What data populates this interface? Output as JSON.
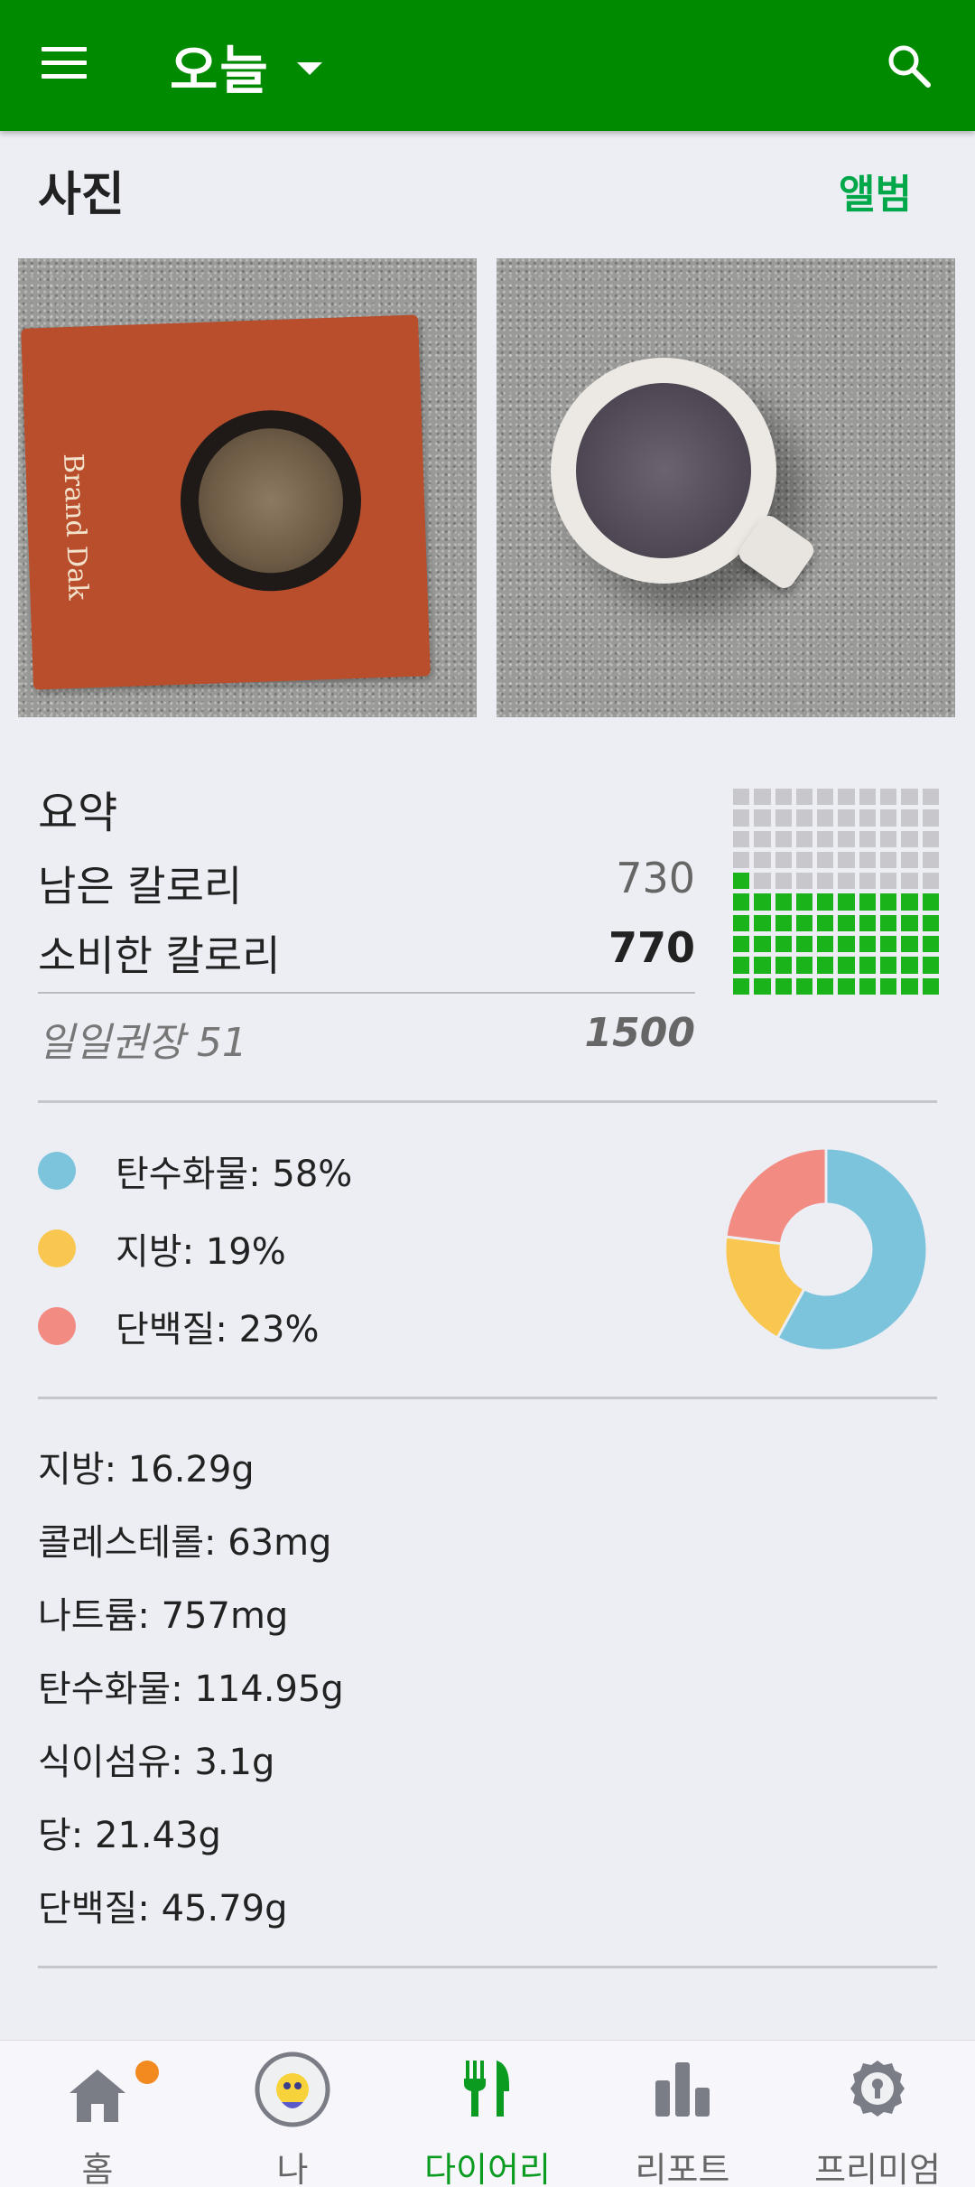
{
  "appbar": {
    "title": "오늘",
    "menu_icon": "menu-icon",
    "search_icon": "search-icon"
  },
  "photos": {
    "title": "사진",
    "album_link": "앨범",
    "items": [
      {
        "brand_text": "Brand Dak"
      },
      {}
    ]
  },
  "summary": {
    "title": "요약",
    "remaining_label": "남은 칼로리",
    "remaining_value": "730",
    "consumed_label": "소비한 칼로리",
    "consumed_value": "770",
    "daily_label": "일일권장 51",
    "daily_value": "1500",
    "grid_filled_fraction": 0.51
  },
  "macros": {
    "items": [
      {
        "label": "탄수화물: 58%",
        "percent": 58,
        "color": "#7cc3dc"
      },
      {
        "label": "지방: 19%",
        "percent": 19,
        "color": "#f9c74f"
      },
      {
        "label": "단백질: 23%",
        "percent": 23,
        "color": "#f28b82"
      }
    ]
  },
  "nutrients": [
    "지방: 16.29g",
    "콜레스테롤: 63mg",
    "나트륨: 757mg",
    "탄수화물: 114.95g",
    "식이섬유: 3.1g",
    "당: 21.43g",
    "단백질: 45.79g"
  ],
  "bottom_nav": {
    "active": "diary",
    "items": [
      {
        "key": "home",
        "label": "홈",
        "icon": "home-icon"
      },
      {
        "key": "me",
        "label": "나",
        "icon": "avatar"
      },
      {
        "key": "diary",
        "label": "다이어리",
        "icon": "fork-knife-icon"
      },
      {
        "key": "report",
        "label": "리포트",
        "icon": "bar-chart-icon"
      },
      {
        "key": "premium",
        "label": "프리미엄",
        "icon": "premium-badge-icon"
      }
    ]
  },
  "colors": {
    "appbar": "#008a00",
    "accent": "#00a84a",
    "grid_on": "#1ab31a",
    "grid_off": "#c7c7cc",
    "notification": "#f28a20"
  }
}
